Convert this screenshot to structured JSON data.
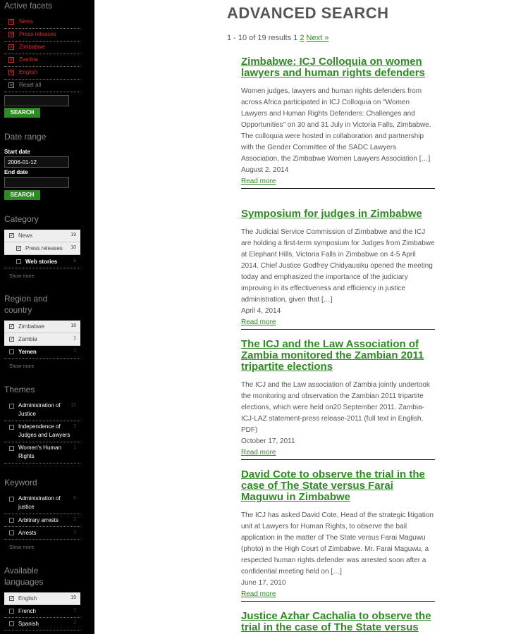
{
  "sidebar": {
    "active_facets": {
      "heading": "Active facets",
      "items": [
        "News",
        "Press releases",
        "Zimbabwe",
        "Zambia",
        "English"
      ],
      "reset_label": "Reset all",
      "search_label": "SEARCH"
    },
    "date_range": {
      "heading": "Date range",
      "start_label": "Start date",
      "start_value": "2006-01-12",
      "end_label": "End date",
      "end_value": "",
      "search_label": "SEARCH"
    },
    "category": {
      "heading": "Category",
      "items": [
        {
          "label": "News",
          "count": "19"
        },
        {
          "label": "Press releases",
          "count": "10"
        },
        {
          "label": "Web stories",
          "count": "9"
        }
      ],
      "show_more": "Show more"
    },
    "region": {
      "heading": "Region and country",
      "items": [
        {
          "label": "Zimbabwe",
          "count": "18"
        },
        {
          "label": "Zambia",
          "count": "1"
        },
        {
          "label": "Yemen",
          "count": "2"
        }
      ],
      "show_more": "Show more"
    },
    "themes": {
      "heading": "Themes",
      "items": [
        {
          "label": "Administration of Justice",
          "count": "15"
        },
        {
          "label": "Independence of Judges and Lawyers",
          "count": "3"
        },
        {
          "label": "Women's Human Rights",
          "count": "1"
        }
      ]
    },
    "keyword": {
      "heading": "Keyword",
      "items": [
        {
          "label": "Administration of justice",
          "count": "6"
        },
        {
          "label": "Arbitrary arrests",
          "count": "2"
        },
        {
          "label": "Arrests",
          "count": "2"
        }
      ],
      "show_more": "Show more"
    },
    "languages": {
      "heading": "Available languages",
      "items": [
        {
          "label": "English",
          "count": "19"
        },
        {
          "label": "French",
          "count": "2"
        },
        {
          "label": "Spanish",
          "count": "2"
        }
      ]
    }
  },
  "main": {
    "title": "ADVANCED SEARCH",
    "pager": {
      "summary": "1 - 10 of 19 results 1",
      "page2": "2",
      "next": "Next »"
    },
    "results": [
      {
        "title": "Zimbabwe: ICJ Colloquia on women lawyers and human rights defenders",
        "excerpt": "Women judges, lawyers and human rights defenders from across Africa participated in ICJ Colloquia on \"Women Lawyers and Human Rights Defenders: Challenges and Opportunities\" on 30 and 31 July in Victoria Falls, Zimbabwe. The colloquia were hosted in collaboration and partnership with the Gender Committee of the SADC Lawyers Association, the Zimbabwe Women Lawyers Association […]",
        "date": "August 2, 2014",
        "more": "Read more"
      },
      {
        "title": "Symposium for judges in Zimbabwe",
        "excerpt": "The Judicial Service Commission of Zimbabwe and the ICJ are holding a first-term symposium for Judges from Zimbabwe at Elephant Hills, Victoria Falls in Zimbabwe on 4-5 April 2014. Chief Justice Godfrey Chidyausiku opened the meeting today and emphasized the importance of the judiciary improving in its effectiveness and efficiency in justice administration, given that […]",
        "date": "April 4, 2014",
        "more": "Read more"
      },
      {
        "title": "The ICJ and the Law Association of Zambia monitored the Zambian 2011 tripartite elections",
        "excerpt": "The ICJ and the Law association of Zambia jointly undertook the monitoring and observation the Zambian 2011 tripartite elections, which were held on20 September 2011. Zambia-ICJ-LAZ statement-press release-2011 (full text in English, PDF)",
        "date": "October 17, 2011",
        "more": "Read more"
      },
      {
        "title": "David Cote to observe the trial in the case of The State versus Farai Maguwu in Zimbabwe",
        "excerpt": "The ICJ has asked David Cote, Head of the strategic litigation unit at Lawyers for Human Rights, to  observe the bail application in the matter of The State versus Farai Maguwu (photo) in the High Court of Zimbabwe. Mr. Farai Maguwu, a respected human rights defender was arrested soon after a confidential meeting held on […]",
        "date": "June 17, 2010",
        "more": "Read more"
      },
      {
        "title": "Justice Azhar Cachalia to observe the trial in the case of The State versus",
        "excerpt": "",
        "date": "",
        "more": ""
      }
    ]
  }
}
